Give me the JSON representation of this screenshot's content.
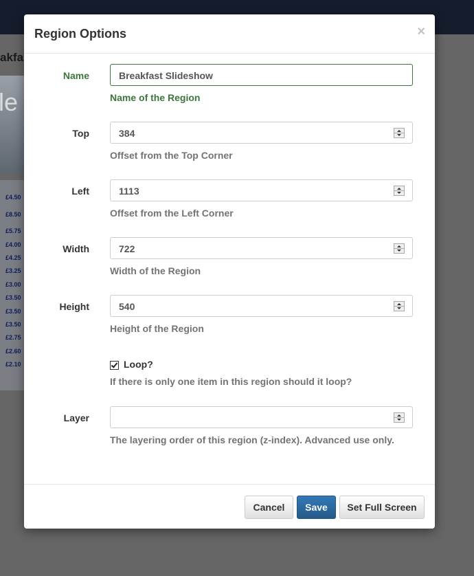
{
  "background": {
    "title": "akfas",
    "image_text": "le",
    "prices": [
      "£4.50",
      "£8.50",
      "£5.75",
      "£4.00",
      "£4.25",
      "£3.25",
      "£3.00",
      "£3.50",
      "£3.50",
      "£3.50",
      "£2.75",
      "£2.60",
      "£2.10"
    ]
  },
  "modal": {
    "title": "Region Options",
    "close": "×",
    "fields": {
      "name": {
        "label": "Name",
        "value": "Breakfast Slideshow",
        "help": "Name of the Region"
      },
      "top": {
        "label": "Top",
        "value": "384",
        "help": "Offset from the Top Corner"
      },
      "left": {
        "label": "Left",
        "value": "1113",
        "help": "Offset from the Left Corner"
      },
      "width": {
        "label": "Width",
        "value": "722",
        "help": "Width of the Region"
      },
      "height": {
        "label": "Height",
        "value": "540",
        "help": "Height of the Region"
      },
      "layer": {
        "label": "Layer",
        "value": "",
        "help": "The layering order of this region (z-index). Advanced use only."
      }
    },
    "loop": {
      "label": "Loop?",
      "checked": true,
      "help": "If there is only one item in this region should it loop?"
    },
    "footer": {
      "cancel": "Cancel",
      "save": "Save",
      "full_screen": "Set Full Screen"
    }
  },
  "colors": {
    "success": "#3c763d",
    "primary": "#337ab7",
    "topbar": "#151c2c"
  }
}
